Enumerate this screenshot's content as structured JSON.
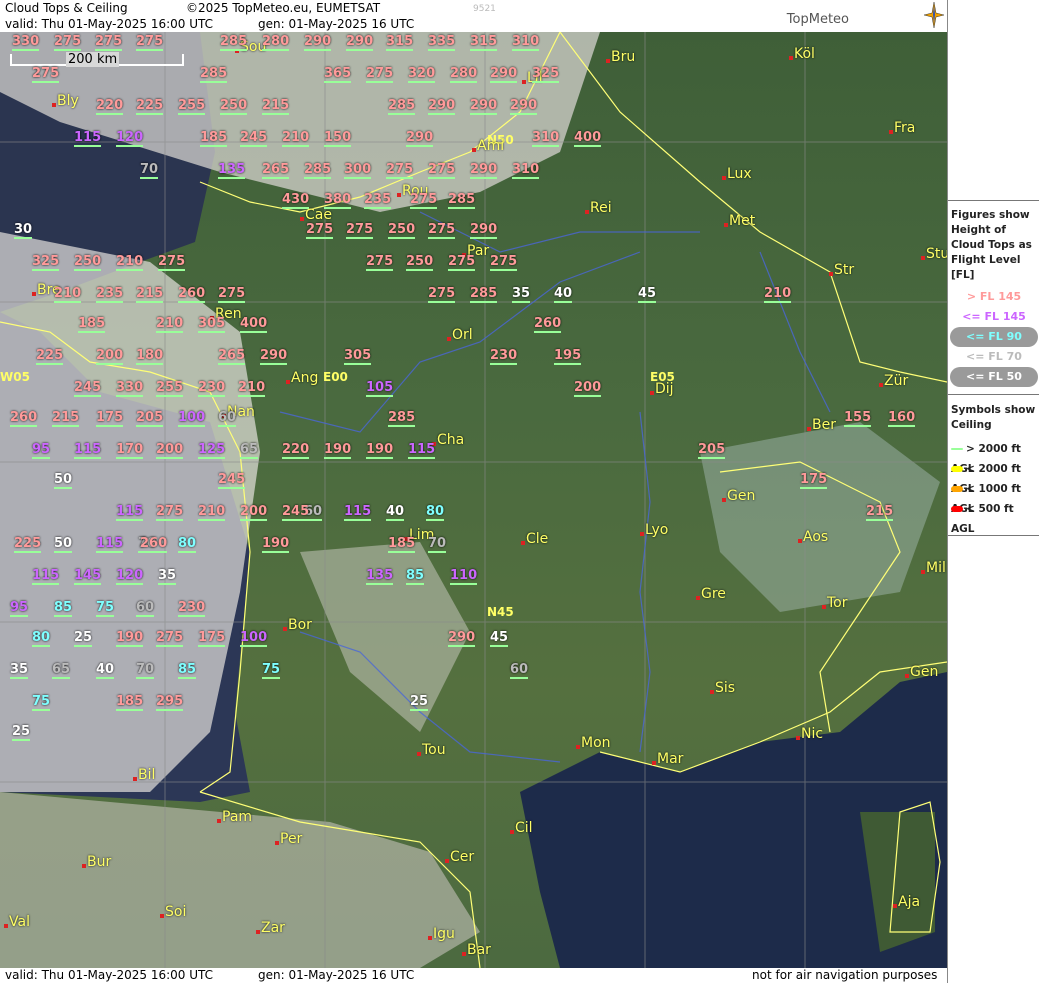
{
  "header": {
    "title": "Cloud Tops & Ceiling",
    "copyright": "©2025 TopMeteo.eu, EUMETSAT",
    "code": "9521",
    "valid": "valid:  Thu  01-May-2025  16:00 UTC",
    "gen": "gen: 01-May-2025 16 UTC",
    "logo": "TopMeteo"
  },
  "footer": {
    "valid": "valid:  Thu  01-May-2025  16:00 UTC",
    "gen": "gen: 01-May-2025 16 UTC",
    "disclaimer": "not for air navigation purposes"
  },
  "scale": {
    "label": "200 km"
  },
  "legend": {
    "title": "Figures show Height of Cloud Tops as Flight Level  [FL]",
    "levels": [
      {
        "text": "> FL 145",
        "color": "#ff9a9a"
      },
      {
        "text": "<= FL 145",
        "color": "#cc66ff"
      },
      {
        "text": "<= FL 90",
        "color": "#7fffff"
      },
      {
        "text": "<= FL 70",
        "color": "#bbbbbb"
      },
      {
        "text": "<= FL 50",
        "color": "#ffffff"
      }
    ],
    "symbols_title": "Symbols show Ceiling",
    "symbols": [
      {
        "text": "> 2000 ft AGL",
        "color": "#99ff99"
      },
      {
        "text": "< 2000 ft AGL",
        "color": "#ffff00"
      },
      {
        "text": "< 1000 ft AGL",
        "color": "#ffa500"
      },
      {
        "text": "< 500 ft AGL",
        "color": "#ff0000"
      }
    ]
  },
  "grid_labels": [
    "N50",
    "N45",
    "E00",
    "E05",
    "W05"
  ],
  "cities": [
    "Sou",
    "Bly",
    "Lil",
    "Bru",
    "Köl",
    "Ami",
    "Fra",
    "Lux",
    "Rou",
    "Cae",
    "Rei",
    "Met",
    "Par",
    "Stu",
    "Str",
    "Bre",
    "Ren",
    "Orl",
    "Ang",
    "Nan",
    "Dij",
    "Zür",
    "Ber",
    "Cha",
    "Gen",
    "Lim",
    "Cle",
    "Lyo",
    "Aos",
    "Mil",
    "Gre",
    "Tor",
    "Bor",
    "Sis",
    "Gen",
    "Nic",
    "Tou",
    "Mon",
    "Mar",
    "Bil",
    "Pam",
    "Per",
    "Cil",
    "Bur",
    "Cer",
    "Soi",
    "Val",
    "Zar",
    "Igu",
    "Bar",
    "Aja"
  ],
  "values": [
    "330",
    "275",
    "275",
    "275",
    "285",
    "280",
    "290",
    "290",
    "315",
    "335",
    "315",
    "310",
    "275",
    "285",
    "365",
    "275",
    "320",
    "280",
    "290",
    "325",
    "220",
    "225",
    "255",
    "250",
    "215",
    "285",
    "290",
    "290",
    "290",
    "115",
    "120",
    "185",
    "245",
    "210",
    "150",
    "290",
    "310",
    "400",
    "70",
    "135",
    "265",
    "285",
    "300",
    "275",
    "275",
    "290",
    "310",
    "430",
    "380",
    "235",
    "275",
    "285",
    "30",
    "275",
    "275",
    "250",
    "275",
    "290",
    "325",
    "250",
    "210",
    "275",
    "275",
    "250",
    "275",
    "275",
    "210",
    "235",
    "215",
    "260",
    "275",
    "275",
    "285",
    "35",
    "40",
    "45",
    "210",
    "185",
    "210",
    "305",
    "400",
    "260",
    "225",
    "200",
    "180",
    "265",
    "290",
    "305",
    "230",
    "195",
    "245",
    "330",
    "255",
    "230",
    "210",
    "105",
    "200",
    "260",
    "215",
    "175",
    "205",
    "100",
    "60",
    "285",
    "205",
    "155",
    "160",
    "95",
    "115",
    "170",
    "200",
    "125",
    "65",
    "220",
    "190",
    "190",
    "115",
    "175",
    "245",
    "60",
    "115",
    "40",
    "80",
    "50",
    "115",
    "275",
    "210",
    "200",
    "245",
    "215",
    "225",
    "50",
    "115",
    "70",
    "80",
    "190",
    "260",
    "185",
    "70",
    "115",
    "145",
    "120",
    "35",
    "135",
    "85",
    "110",
    "95",
    "85",
    "75",
    "60",
    "230",
    "290",
    "45",
    "80",
    "25",
    "190",
    "275",
    "175",
    "100",
    "35",
    "65",
    "40",
    "70",
    "85",
    "75",
    "60",
    "75",
    "185",
    "295",
    "25",
    "25"
  ]
}
